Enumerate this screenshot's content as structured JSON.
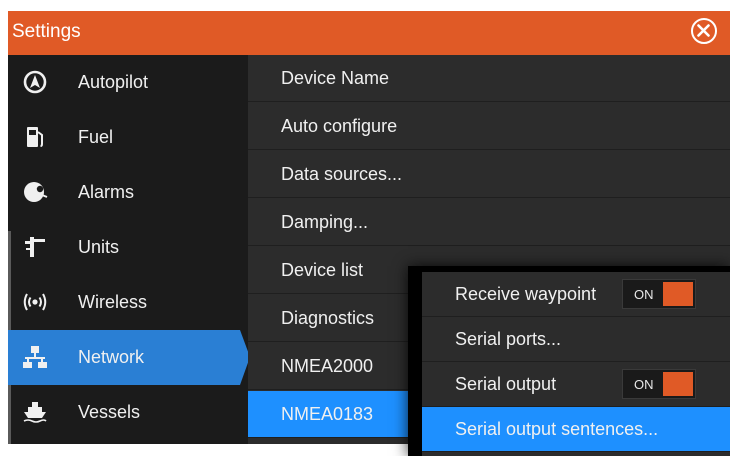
{
  "window": {
    "title": "Settings"
  },
  "colors": {
    "accent": "#e05a26",
    "selected": "#1e90ff",
    "sidebar_selected": "#2a7fd4"
  },
  "sidebar": {
    "items": [
      {
        "label": "Autopilot",
        "icon": "autopilot-icon"
      },
      {
        "label": "Fuel",
        "icon": "fuel-icon"
      },
      {
        "label": "Alarms",
        "icon": "alarm-bell-icon"
      },
      {
        "label": "Units",
        "icon": "units-icon"
      },
      {
        "label": "Wireless",
        "icon": "wireless-icon"
      },
      {
        "label": "Network",
        "icon": "network-icon",
        "selected": true
      },
      {
        "label": "Vessels",
        "icon": "vessels-icon"
      }
    ]
  },
  "network": {
    "items": [
      {
        "label": "Device Name"
      },
      {
        "label": "Auto configure"
      },
      {
        "label": "Data sources..."
      },
      {
        "label": "Damping..."
      },
      {
        "label": "Device list"
      },
      {
        "label": "Diagnostics"
      },
      {
        "label": "NMEA2000"
      },
      {
        "label": "NMEA0183",
        "selected": true
      }
    ]
  },
  "popup": {
    "items": [
      {
        "label": "Receive waypoint",
        "toggle": "ON"
      },
      {
        "label": "Serial ports..."
      },
      {
        "label": "Serial output",
        "toggle": "ON"
      },
      {
        "label": "Serial output sentences...",
        "selected": true
      }
    ]
  }
}
